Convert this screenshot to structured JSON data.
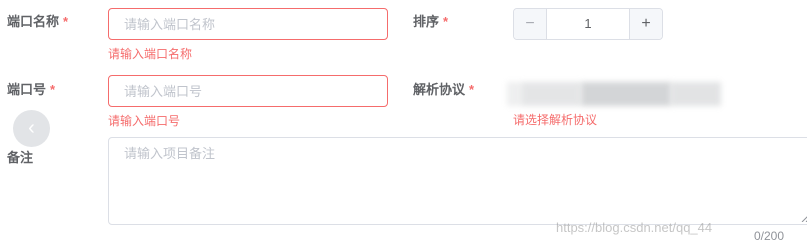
{
  "port_name": {
    "label": "端口名称",
    "required_mark": "*",
    "placeholder": "请输入端口名称",
    "error": "请输入端口名称"
  },
  "sort": {
    "label": "排序",
    "required_mark": "*",
    "minus": "−",
    "plus": "+",
    "value": "1"
  },
  "port_number": {
    "label": "端口号",
    "required_mark": "*",
    "placeholder": "请输入端口号",
    "error": "请输入端口号"
  },
  "protocol": {
    "label": "解析协议",
    "required_mark": "*",
    "error": "请选择解析协议"
  },
  "remark": {
    "label": "备注",
    "placeholder": "请输入项目备注",
    "counter": "0/200"
  },
  "back_button": {
    "icon": "chevron-left-icon",
    "glyph": "‹"
  },
  "watermark": "https://blog.csdn.net/qq_44"
}
